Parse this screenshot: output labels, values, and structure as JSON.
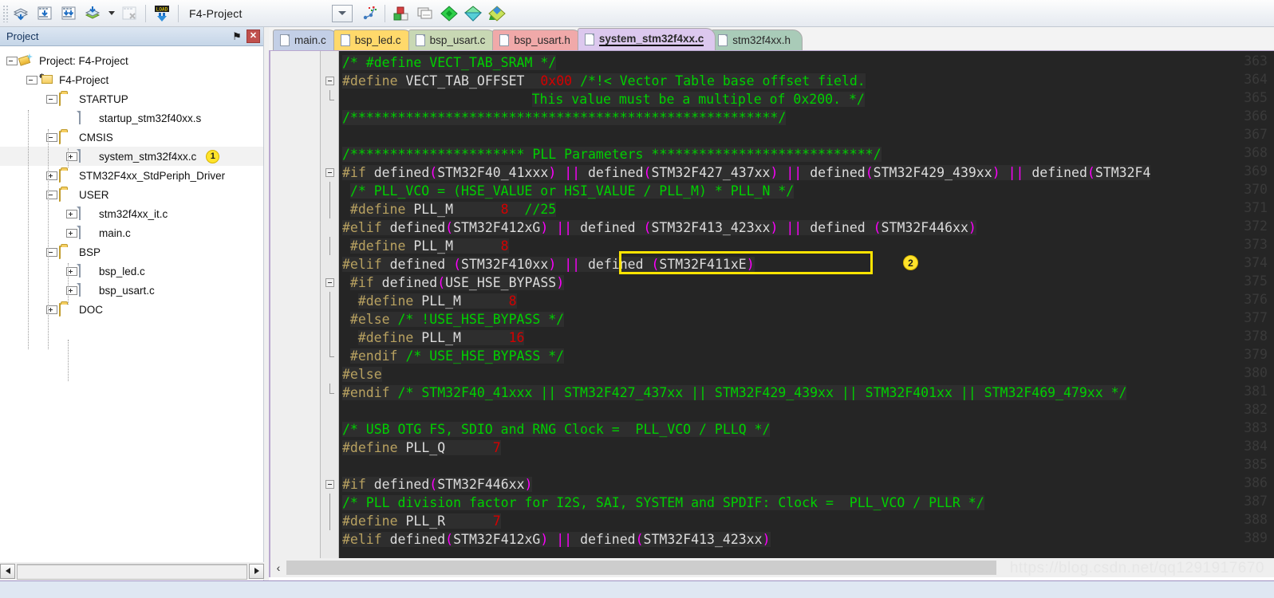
{
  "toolbar": {
    "project_name": "F4-Project",
    "buttons": [
      {
        "name": "translate-icon",
        "title": "Translate"
      },
      {
        "name": "build-icon",
        "title": "Build"
      },
      {
        "name": "rebuild-icon",
        "title": "Rebuild"
      },
      {
        "name": "batch-build-icon",
        "title": "Batch Build"
      },
      {
        "name": "stop-build-icon",
        "title": "Stop Build"
      },
      {
        "name": "load-icon",
        "title": "LOAD"
      }
    ],
    "right_buttons": [
      {
        "name": "target-options-icon",
        "title": "Options for Target"
      },
      {
        "name": "manage-project-icon",
        "title": "Manage Project Items"
      },
      {
        "name": "project-window-icon",
        "title": "Project Window"
      },
      {
        "name": "books-window-icon",
        "title": "Books Window"
      },
      {
        "name": "functions-window-icon",
        "title": "Functions Window"
      },
      {
        "name": "templates-window-icon",
        "title": "Templates Window"
      }
    ],
    "load_label": "LOAD"
  },
  "project_panel": {
    "title": "Project",
    "pin_glyph": "⚑",
    "close_glyph": "✕",
    "tree": [
      {
        "label": "Project: F4-Project",
        "depth": 0,
        "icon": "project-icon",
        "twisty": "expanded",
        "badge": null
      },
      {
        "label": "F4-Project",
        "depth": 1,
        "icon": "target-icon",
        "twisty": "expanded",
        "badge": null
      },
      {
        "label": "STARTUP",
        "depth": 2,
        "icon": "folder-open-icon",
        "twisty": "expanded",
        "badge": null
      },
      {
        "label": "startup_stm32f40xx.s",
        "depth": 3,
        "icon": "file-icon",
        "twisty": "none",
        "badge": null
      },
      {
        "label": "CMSIS",
        "depth": 2,
        "icon": "folder-open-icon",
        "twisty": "expanded",
        "badge": null
      },
      {
        "label": "system_stm32f4xx.c",
        "depth": 3,
        "icon": "file-icon",
        "twisty": "collapsed",
        "badge": "1",
        "selected": true
      },
      {
        "label": "STM32F4xx_StdPeriph_Driver",
        "depth": 2,
        "icon": "folder-closed-icon",
        "twisty": "collapsed",
        "badge": null
      },
      {
        "label": "USER",
        "depth": 2,
        "icon": "folder-open-icon",
        "twisty": "expanded",
        "badge": null
      },
      {
        "label": "stm32f4xx_it.c",
        "depth": 3,
        "icon": "file-icon",
        "twisty": "collapsed",
        "badge": null
      },
      {
        "label": "main.c",
        "depth": 3,
        "icon": "file-icon",
        "twisty": "collapsed",
        "badge": null
      },
      {
        "label": "BSP",
        "depth": 2,
        "icon": "folder-open-icon",
        "twisty": "expanded",
        "badge": null
      },
      {
        "label": "bsp_led.c",
        "depth": 3,
        "icon": "file-icon",
        "twisty": "collapsed",
        "badge": null
      },
      {
        "label": "bsp_usart.c",
        "depth": 3,
        "icon": "file-icon",
        "twisty": "collapsed",
        "badge": null
      },
      {
        "label": "DOC",
        "depth": 2,
        "icon": "folder-closed-icon",
        "twisty": "collapsed",
        "badge": null
      }
    ]
  },
  "editor": {
    "tabs": [
      {
        "label": "main.c",
        "color": "#c3cfe6",
        "active": false
      },
      {
        "label": "bsp_led.c",
        "color": "#ffd96b",
        "active": false
      },
      {
        "label": "bsp_usart.c",
        "color": "#c8d8b4",
        "active": false
      },
      {
        "label": "bsp_usart.h",
        "color": "#f0a9a9",
        "active": false
      },
      {
        "label": "system_stm32f4xx.c",
        "color": "#dcc8ee",
        "active": true
      },
      {
        "label": "stm32f4xx.h",
        "color": "#a9cbb8",
        "active": false
      }
    ],
    "first_line_number": 363,
    "highlight_badge": "2",
    "lines": [
      {
        "n": 363,
        "fold": "none",
        "tokens": [
          {
            "t": "/* #define VECT_TAB_SRAM */",
            "c": "cm"
          }
        ]
      },
      {
        "n": 364,
        "fold": "start",
        "tokens": [
          {
            "t": "#define",
            "c": "pp"
          },
          {
            "t": " ",
            "c": "pl"
          },
          {
            "t": "VECT_TAB_OFFSET",
            "c": "id"
          },
          {
            "t": "  ",
            "c": "pl"
          },
          {
            "t": "0x00",
            "c": "num"
          },
          {
            "t": " ",
            "c": "pl"
          },
          {
            "t": "/*!< Vector Table base offset field.",
            "c": "cm"
          }
        ]
      },
      {
        "n": 365,
        "fold": "end",
        "indent": 24,
        "tokens": [
          {
            "t": "This value must be a multiple of 0x200. */",
            "c": "cm"
          }
        ]
      },
      {
        "n": 366,
        "fold": "none",
        "tokens": [
          {
            "t": "/******************************************************/",
            "c": "cm"
          }
        ]
      },
      {
        "n": 367,
        "fold": "none",
        "tokens": []
      },
      {
        "n": 368,
        "fold": "none",
        "tokens": [
          {
            "t": "/********************** PLL Parameters ****************************/",
            "c": "cm"
          }
        ]
      },
      {
        "n": 369,
        "fold": "start",
        "tokens": [
          {
            "t": "#if",
            "c": "pp"
          },
          {
            "t": " ",
            "c": "pl"
          },
          {
            "t": "defined",
            "c": "id"
          },
          {
            "t": "(",
            "c": "op"
          },
          {
            "t": "STM32F40_41xxx",
            "c": "id"
          },
          {
            "t": ")",
            "c": "op"
          },
          {
            "t": " ",
            "c": "pl"
          },
          {
            "t": "||",
            "c": "op"
          },
          {
            "t": " ",
            "c": "pl"
          },
          {
            "t": "defined",
            "c": "id"
          },
          {
            "t": "(",
            "c": "op"
          },
          {
            "t": "STM32F427_437xx",
            "c": "id"
          },
          {
            "t": ")",
            "c": "op"
          },
          {
            "t": " ",
            "c": "pl"
          },
          {
            "t": "||",
            "c": "op"
          },
          {
            "t": " ",
            "c": "pl"
          },
          {
            "t": "defined",
            "c": "id"
          },
          {
            "t": "(",
            "c": "op"
          },
          {
            "t": "STM32F429_439xx",
            "c": "id"
          },
          {
            "t": ")",
            "c": "op"
          },
          {
            "t": " ",
            "c": "pl"
          },
          {
            "t": "||",
            "c": "op"
          },
          {
            "t": " ",
            "c": "pl"
          },
          {
            "t": "defined",
            "c": "id"
          },
          {
            "t": "(",
            "c": "op"
          },
          {
            "t": "STM32F4",
            "c": "id"
          }
        ]
      },
      {
        "n": 370,
        "fold": "bar",
        "indent": 1,
        "tokens": [
          {
            "t": "/* PLL_VCO = (HSE_VALUE or HSI_VALUE / PLL_M) * PLL_N */",
            "c": "cm"
          }
        ]
      },
      {
        "n": 371,
        "fold": "bar",
        "indent": 1,
        "tokens": [
          {
            "t": "#define",
            "c": "pp"
          },
          {
            "t": " ",
            "c": "pl"
          },
          {
            "t": "PLL_M",
            "c": "id"
          },
          {
            "t": "      ",
            "c": "pl"
          },
          {
            "t": "8",
            "c": "num"
          },
          {
            "t": "  ",
            "c": "pl"
          },
          {
            "t": "//25",
            "c": "cm"
          }
        ]
      },
      {
        "n": 372,
        "fold": "none",
        "tokens": [
          {
            "t": "#elif",
            "c": "pp"
          },
          {
            "t": " ",
            "c": "pl"
          },
          {
            "t": "defined",
            "c": "id"
          },
          {
            "t": "(",
            "c": "op"
          },
          {
            "t": "STM32F412xG",
            "c": "id"
          },
          {
            "t": ")",
            "c": "op"
          },
          {
            "t": " ",
            "c": "pl"
          },
          {
            "t": "||",
            "c": "op"
          },
          {
            "t": " ",
            "c": "pl"
          },
          {
            "t": "defined",
            "c": "id"
          },
          {
            "t": " ",
            "c": "pl"
          },
          {
            "t": "(",
            "c": "op"
          },
          {
            "t": "STM32F413_423xx",
            "c": "id"
          },
          {
            "t": ")",
            "c": "op"
          },
          {
            "t": " ",
            "c": "pl"
          },
          {
            "t": "||",
            "c": "op"
          },
          {
            "t": " ",
            "c": "pl"
          },
          {
            "t": "defined",
            "c": "id"
          },
          {
            "t": " ",
            "c": "pl"
          },
          {
            "t": "(",
            "c": "op"
          },
          {
            "t": "STM32F446xx",
            "c": "id"
          },
          {
            "t": ")",
            "c": "op"
          }
        ]
      },
      {
        "n": 373,
        "fold": "bar",
        "indent": 1,
        "tokens": [
          {
            "t": "#define",
            "c": "pp"
          },
          {
            "t": " ",
            "c": "pl"
          },
          {
            "t": "PLL_M",
            "c": "id"
          },
          {
            "t": "      ",
            "c": "pl"
          },
          {
            "t": "8",
            "c": "num"
          }
        ]
      },
      {
        "n": 374,
        "fold": "none",
        "tokens": [
          {
            "t": "#elif",
            "c": "pp"
          },
          {
            "t": " ",
            "c": "pl"
          },
          {
            "t": "defined",
            "c": "id"
          },
          {
            "t": " ",
            "c": "pl"
          },
          {
            "t": "(",
            "c": "op"
          },
          {
            "t": "STM32F410xx",
            "c": "id"
          },
          {
            "t": ")",
            "c": "op"
          },
          {
            "t": " ",
            "c": "pl"
          },
          {
            "t": "||",
            "c": "op"
          },
          {
            "t": " ",
            "c": "pl"
          },
          {
            "t": "defined",
            "c": "id"
          },
          {
            "t": " ",
            "c": "pl"
          },
          {
            "t": "(",
            "c": "op"
          },
          {
            "t": "STM32F411xE",
            "c": "id"
          },
          {
            "t": ")",
            "c": "op"
          }
        ]
      },
      {
        "n": 375,
        "fold": "start",
        "indent": 1,
        "tokens": [
          {
            "t": "#if",
            "c": "pp"
          },
          {
            "t": " ",
            "c": "pl"
          },
          {
            "t": "defined",
            "c": "id"
          },
          {
            "t": "(",
            "c": "op"
          },
          {
            "t": "USE_HSE_BYPASS",
            "c": "id"
          },
          {
            "t": ")",
            "c": "op"
          }
        ]
      },
      {
        "n": 376,
        "fold": "bar",
        "indent": 2,
        "tokens": [
          {
            "t": "#define",
            "c": "pp"
          },
          {
            "t": " ",
            "c": "pl"
          },
          {
            "t": "PLL_M",
            "c": "id"
          },
          {
            "t": "      ",
            "c": "pl"
          },
          {
            "t": "8",
            "c": "num"
          }
        ]
      },
      {
        "n": 377,
        "fold": "bar",
        "indent": 1,
        "tokens": [
          {
            "t": "#else",
            "c": "pp"
          },
          {
            "t": " ",
            "c": "pl"
          },
          {
            "t": "/* !USE_HSE_BYPASS */",
            "c": "cm"
          }
        ]
      },
      {
        "n": 378,
        "fold": "bar",
        "indent": 2,
        "tokens": [
          {
            "t": "#define",
            "c": "pp"
          },
          {
            "t": " ",
            "c": "pl"
          },
          {
            "t": "PLL_M",
            "c": "id"
          },
          {
            "t": "      ",
            "c": "pl"
          },
          {
            "t": "16",
            "c": "num"
          }
        ]
      },
      {
        "n": 379,
        "fold": "end",
        "indent": 1,
        "tokens": [
          {
            "t": "#endif",
            "c": "pp"
          },
          {
            "t": " ",
            "c": "pl"
          },
          {
            "t": "/* USE_HSE_BYPASS */",
            "c": "cm"
          }
        ]
      },
      {
        "n": 380,
        "fold": "none",
        "tokens": [
          {
            "t": "#else",
            "c": "pp"
          }
        ]
      },
      {
        "n": 381,
        "fold": "end",
        "tokens": [
          {
            "t": "#endif",
            "c": "pp"
          },
          {
            "t": " ",
            "c": "pl"
          },
          {
            "t": "/* STM32F40_41xxx || STM32F427_437xx || STM32F429_439xx || STM32F401xx || STM32F469_479xx */",
            "c": "cm"
          }
        ]
      },
      {
        "n": 382,
        "fold": "none",
        "tokens": []
      },
      {
        "n": 383,
        "fold": "none",
        "tokens": [
          {
            "t": "/* USB OTG FS, SDIO and RNG Clock =  PLL_VCO / PLLQ */",
            "c": "cm"
          }
        ]
      },
      {
        "n": 384,
        "fold": "none",
        "tokens": [
          {
            "t": "#define",
            "c": "pp"
          },
          {
            "t": " ",
            "c": "pl"
          },
          {
            "t": "PLL_Q",
            "c": "id"
          },
          {
            "t": "      ",
            "c": "pl"
          },
          {
            "t": "7",
            "c": "num"
          }
        ]
      },
      {
        "n": 385,
        "fold": "none",
        "tokens": []
      },
      {
        "n": 386,
        "fold": "start",
        "tokens": [
          {
            "t": "#if",
            "c": "pp"
          },
          {
            "t": " ",
            "c": "pl"
          },
          {
            "t": "defined",
            "c": "id"
          },
          {
            "t": "(",
            "c": "op"
          },
          {
            "t": "STM32F446xx",
            "c": "id"
          },
          {
            "t": ")",
            "c": "op"
          }
        ]
      },
      {
        "n": 387,
        "fold": "bar",
        "tokens": [
          {
            "t": "/* PLL division factor for I2S, SAI, SYSTEM and SPDIF: Clock =  PLL_VCO / PLLR */",
            "c": "cm"
          }
        ]
      },
      {
        "n": 388,
        "fold": "bar",
        "tokens": [
          {
            "t": "#define",
            "c": "pp"
          },
          {
            "t": " ",
            "c": "pl"
          },
          {
            "t": "PLL_R",
            "c": "id"
          },
          {
            "t": "      ",
            "c": "pl"
          },
          {
            "t": "7",
            "c": "num"
          }
        ]
      },
      {
        "n": 389,
        "fold": "none",
        "tokens": [
          {
            "t": "#elif",
            "c": "pp"
          },
          {
            "t": " ",
            "c": "pl"
          },
          {
            "t": "defined",
            "c": "id"
          },
          {
            "t": "(",
            "c": "op"
          },
          {
            "t": "STM32F412xG",
            "c": "id"
          },
          {
            "t": ")",
            "c": "op"
          },
          {
            "t": " ",
            "c": "pl"
          },
          {
            "t": "||",
            "c": "op"
          },
          {
            "t": " ",
            "c": "pl"
          },
          {
            "t": "defined",
            "c": "id"
          },
          {
            "t": "(",
            "c": "op"
          },
          {
            "t": "STM32F413_423xx",
            "c": "id"
          },
          {
            "t": ")",
            "c": "op"
          }
        ]
      }
    ]
  },
  "scrollbars": {
    "project_left_glyph": "◀",
    "project_right_glyph": "▶",
    "editor_left_glyph": "‹"
  },
  "watermark": "https://blog.csdn.net/qq1291917670",
  "colors": {
    "editor_bg": "#252525",
    "code_bg": "#2e2e2e",
    "comment": "#00d000",
    "preproc": "#b8a160",
    "number": "#d40000",
    "operator": "#ff00ff",
    "identifier": "#dcdcdc",
    "highlight_border": "#ffe400",
    "badge_bg": "#ffe32b"
  }
}
